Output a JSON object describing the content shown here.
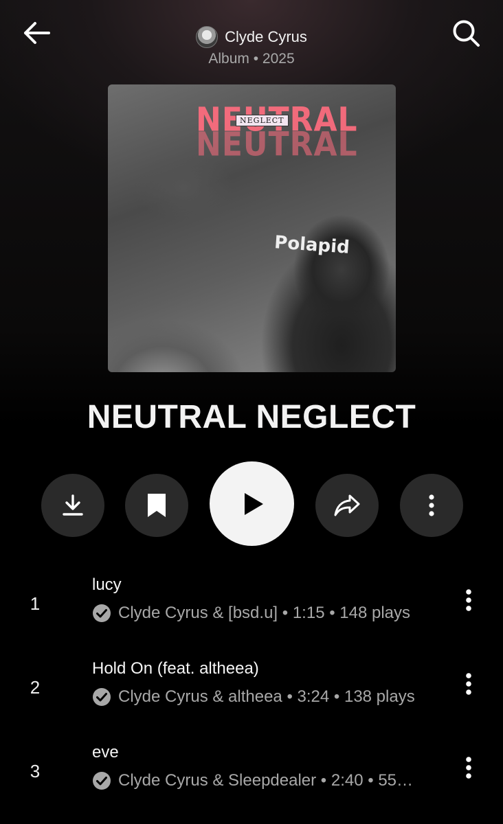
{
  "header": {
    "artist": "Clyde Cyrus",
    "subtitle": "Album • 2025"
  },
  "album": {
    "title": "NEUTRAL NEGLECT",
    "cover_text": {
      "word1": "NEUTRAL",
      "word2": "NEGLECT",
      "shirt": "Polapid"
    }
  },
  "controls": [
    "download-icon",
    "bookmark-icon",
    "play-icon",
    "share-icon",
    "more-vertical-icon"
  ],
  "tracks": [
    {
      "number": "1",
      "title": "lucy",
      "meta": "Clyde Cyrus & [bsd.u] • 1:15 • 148 plays"
    },
    {
      "number": "2",
      "title": "Hold On (feat. altheea)",
      "meta": "Clyde Cyrus & altheea • 3:24 • 138 plays"
    },
    {
      "number": "3",
      "title": "eve",
      "meta": "Clyde Cyrus & Sleepdealer • 2:40 • 55…"
    }
  ],
  "colors": {
    "background": "#000000",
    "control_bg": "#2a2a2a",
    "play_bg": "#f3f3f3",
    "cover_accent": "#ff6d7f",
    "secondary_text": "#a8a8a8"
  }
}
